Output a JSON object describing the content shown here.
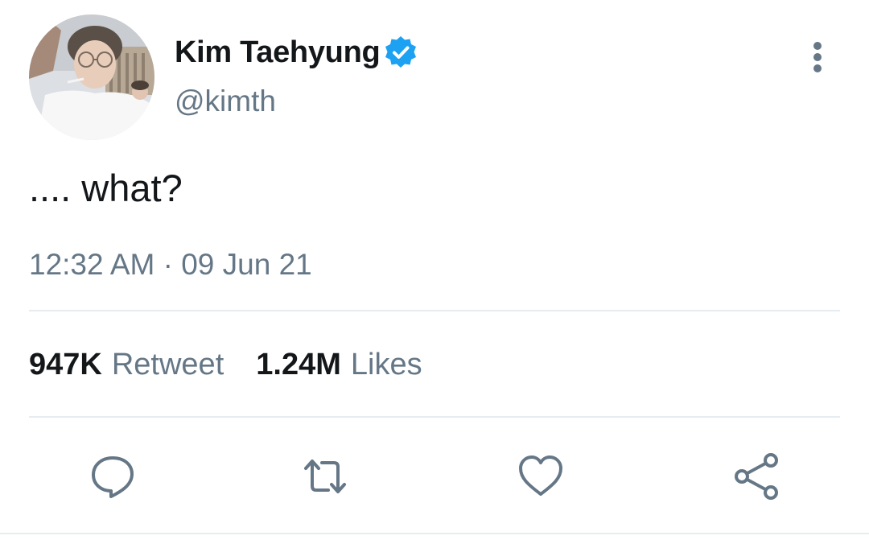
{
  "tweet": {
    "author": {
      "display_name": "Kim Taehyung",
      "handle": "@kimth",
      "verified": true,
      "avatar_icon": "profile-photo"
    },
    "text": ".... what?",
    "timestamp": "12:32 AM · 09 Jun 21",
    "stats": {
      "retweets_count": "947K",
      "retweets_label": "Retweet",
      "likes_count": "1.24M",
      "likes_label": "Likes"
    },
    "actions": [
      {
        "name": "reply",
        "icon": "comment-icon"
      },
      {
        "name": "retweet",
        "icon": "retweet-icon"
      },
      {
        "name": "like",
        "icon": "heart-icon"
      },
      {
        "name": "share",
        "icon": "share-icon"
      }
    ]
  },
  "colors": {
    "text_primary": "#14171a",
    "text_secondary": "#657786",
    "verified_blue": "#1da1f2",
    "divider": "#e6ecf0"
  }
}
